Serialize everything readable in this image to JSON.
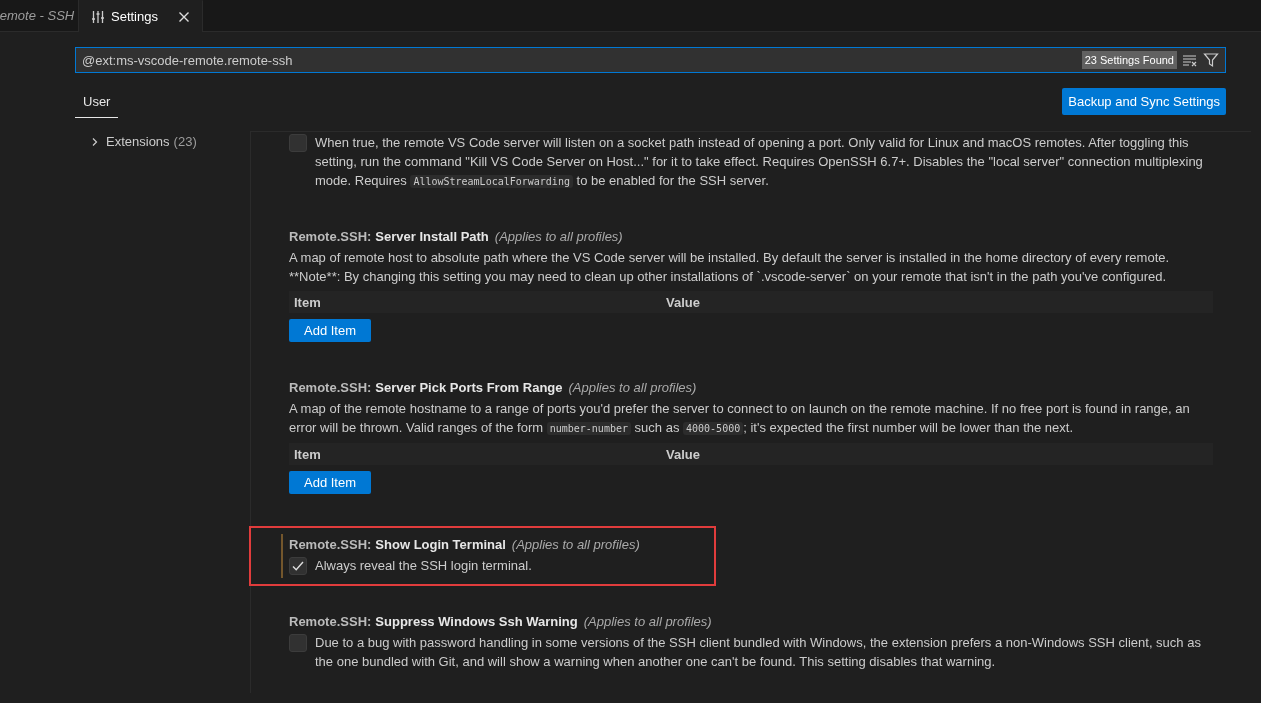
{
  "tabs": [
    {
      "label": "emote - SSH",
      "preview": true,
      "selected": false,
      "kind": "plain"
    },
    {
      "label": "Settings",
      "preview": false,
      "selected": true,
      "kind": "settings"
    }
  ],
  "search": {
    "value": "@ext:ms-vscode-remote.remote-ssh",
    "result_count": "23 Settings Found"
  },
  "scope_tabs": [
    {
      "label": "User",
      "selected": true
    }
  ],
  "sync_button": "Backup and Sync Settings",
  "tree": [
    {
      "label": "Extensions",
      "count": "(23)",
      "expanded": false
    }
  ],
  "settings": [
    {
      "kind": "checkbox",
      "checked": false,
      "modified": false,
      "highlighted": false,
      "description": [
        {
          "kind": "text",
          "text": "When true, the remote VS Code server will listen on a socket path instead of opening a port. Only valid for Linux and macOS remotes. After toggling this setting, run the command \"Kill VS Code Server on Host...\" for it to take effect. Requires OpenSSH 6.7+. Disables the \"local server\" connection multiplexing mode. Requires "
        },
        {
          "kind": "code",
          "text": "AllowStreamLocalForwarding"
        },
        {
          "kind": "text",
          "text": " to be enabled for the SSH server."
        }
      ]
    },
    {
      "kind": "object",
      "category": "Remote.SSH:",
      "name": "Server Install Path",
      "scope": "(Applies to all profiles)",
      "modified": false,
      "highlighted": false,
      "description": [
        {
          "kind": "text",
          "text": "A map of remote host to absolute path where the VS Code server will be installed. By default the server is installed in the home directory of every remote. **Note**: By changing this setting you may need to clean up other installations of `.vscode-server` on your remote that isn't in the path you've configured."
        }
      ],
      "columns": [
        "Item",
        "Value"
      ],
      "button": "Add Item"
    },
    {
      "kind": "object",
      "category": "Remote.SSH:",
      "name": "Server Pick Ports From Range",
      "scope": "(Applies to all profiles)",
      "modified": false,
      "highlighted": false,
      "description": [
        {
          "kind": "text",
          "text": "A map of the remote hostname to a range of ports you'd prefer the server to connect to on launch on the remote machine. If no free port is found in range, an error will be thrown. Valid ranges of the form "
        },
        {
          "kind": "code",
          "text": "number-number"
        },
        {
          "kind": "text",
          "text": " such as "
        },
        {
          "kind": "code",
          "text": "4000-5000"
        },
        {
          "kind": "text",
          "text": "; it's expected the first number will be lower than the next."
        }
      ],
      "columns": [
        "Item",
        "Value"
      ],
      "button": "Add Item"
    },
    {
      "kind": "checkbox",
      "category": "Remote.SSH:",
      "name": "Show Login Terminal",
      "scope": "(Applies to all profiles)",
      "checked": true,
      "modified": true,
      "highlighted": true,
      "description": [
        {
          "kind": "text",
          "text": "Always reveal the SSH login terminal."
        }
      ]
    },
    {
      "kind": "checkbox",
      "category": "Remote.SSH:",
      "name": "Suppress Windows Ssh Warning",
      "scope": "(Applies to all profiles)",
      "checked": false,
      "modified": false,
      "highlighted": false,
      "description": [
        {
          "kind": "text",
          "text": "Due to a bug with password handling in some versions of the SSH client bundled with Windows, the extension prefers a non-Windows SSH client, such as the one bundled with Git, and will show a warning when another one can't be found. This setting disables that warning."
        }
      ]
    }
  ]
}
